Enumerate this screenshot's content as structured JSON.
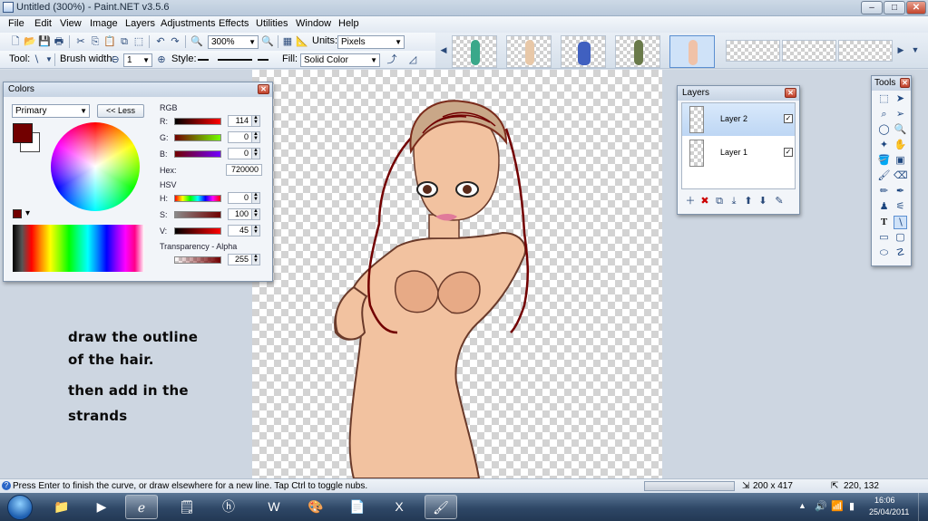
{
  "window": {
    "title": "Untitled (300%) - Paint.NET v3.5.6",
    "min_label": "–",
    "max_label": "□",
    "close_label": "✕"
  },
  "menu": [
    "File",
    "Edit",
    "View",
    "Image",
    "Layers",
    "Adjustments",
    "Effects",
    "Utilities",
    "Window",
    "Help"
  ],
  "toolbar": {
    "zoom_value": "300%",
    "units_label": "Units:",
    "units_value": "Pixels",
    "tool_label": "Tool:",
    "brush_width_label": "Brush width:",
    "brush_width_value": "1",
    "style_label": "Style:",
    "fill_label": "Fill:",
    "fill_value": "Solid Color"
  },
  "colors_panel": {
    "title": "Colors",
    "mode_value": "Primary",
    "less_button": "<< Less",
    "rgb_heading": "RGB",
    "r_label": "R:",
    "r_value": "114",
    "g_label": "G:",
    "g_value": "0",
    "b_label": "B:",
    "b_value": "0",
    "hex_label": "Hex:",
    "hex_value": "720000",
    "hsv_heading": "HSV",
    "h_label": "H:",
    "h_value": "0",
    "s_label": "S:",
    "s_value": "100",
    "v_label": "V:",
    "v_value": "45",
    "alpha_label": "Transparency - Alpha",
    "alpha_value": "255",
    "primary_color": "#720000",
    "secondary_color": "#ffffff"
  },
  "layers_panel": {
    "title": "Layers",
    "layers": [
      {
        "name": "Layer 2",
        "visible": true,
        "selected": true
      },
      {
        "name": "Layer 1",
        "visible": true,
        "selected": false
      }
    ]
  },
  "tools_panel": {
    "title": "Tools",
    "text_tool_glyph": "T"
  },
  "instructions": {
    "line1": "draw the outline",
    "line2": "of the hair.",
    "line3": "then add in the",
    "line4": "strands"
  },
  "statusbar": {
    "hint": "Press Enter to finish the curve, or draw elsewhere for a new line. Tap Ctrl to toggle nubs.",
    "image_size": "200 x 417",
    "cursor_pos": "220, 132"
  },
  "taskbar": {
    "time": "16:06",
    "date": "25/04/2011",
    "apps": [
      "Windows Explorer",
      "Media Player",
      "Internet Explorer",
      "Notepad",
      "HP",
      "Word",
      "Paint",
      "Word Document",
      "Excel",
      "Paint.NET"
    ]
  }
}
